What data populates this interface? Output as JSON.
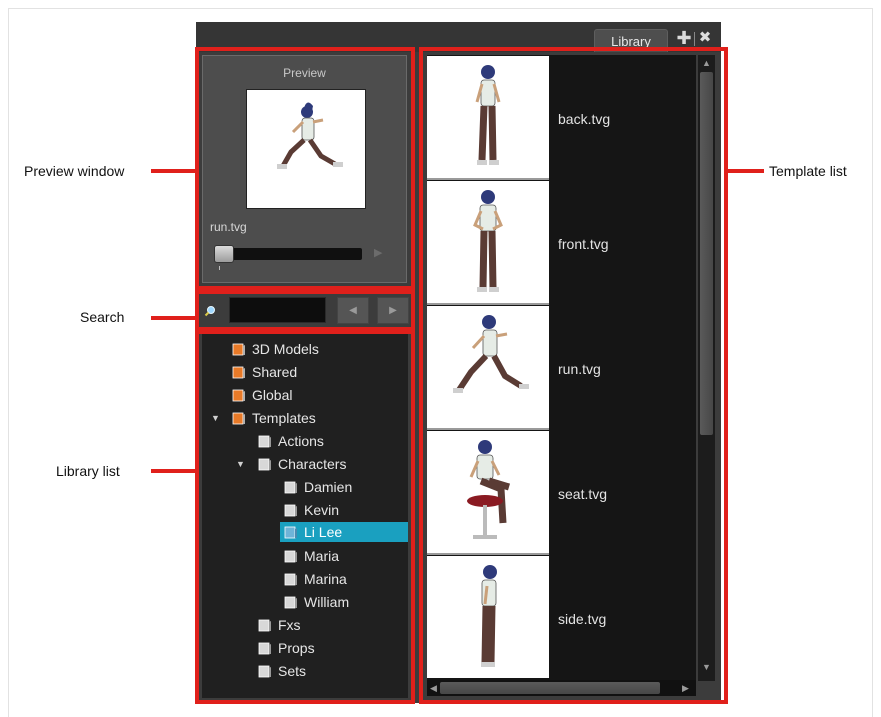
{
  "panel": {
    "tab_label": "Library",
    "tab_actions": [
      {
        "icon": "plus-icon",
        "glyph": "✚"
      },
      {
        "icon": "close-icon",
        "glyph": "✖"
      }
    ]
  },
  "preview": {
    "title": "Preview",
    "file_name": "run.tvg",
    "play_glyph": "▶"
  },
  "search": {
    "value": "",
    "prev_glyph": "◀",
    "next_glyph": "▶"
  },
  "library_tree": [
    {
      "label": "3D Models",
      "level": 0,
      "expanded": null,
      "selected": false,
      "folder_color": "#e87a28"
    },
    {
      "label": "Shared",
      "level": 0,
      "expanded": null,
      "selected": false,
      "folder_color": "#e87a28"
    },
    {
      "label": "Global",
      "level": 0,
      "expanded": null,
      "selected": false,
      "folder_color": "#e87a28"
    },
    {
      "label": "Templates",
      "level": 0,
      "expanded": true,
      "selected": false,
      "folder_color": "#e87a28"
    },
    {
      "label": "Actions",
      "level": 1,
      "expanded": null,
      "selected": false,
      "folder_color": "#d8d8d8"
    },
    {
      "label": "Characters",
      "level": 1,
      "expanded": true,
      "selected": false,
      "folder_color": "#d8d8d8"
    },
    {
      "label": "Damien",
      "level": 2,
      "expanded": null,
      "selected": false,
      "folder_color": "#d8d8d8"
    },
    {
      "label": "Kevin",
      "level": 2,
      "expanded": null,
      "selected": false,
      "folder_color": "#d8d8d8"
    },
    {
      "label": "Li Lee",
      "level": 2,
      "expanded": null,
      "selected": true,
      "folder_color": "#6fb4d8"
    },
    {
      "label": "Maria",
      "level": 2,
      "expanded": null,
      "selected": false,
      "folder_color": "#d8d8d8"
    },
    {
      "label": "Marina",
      "level": 2,
      "expanded": null,
      "selected": false,
      "folder_color": "#d8d8d8"
    },
    {
      "label": "William",
      "level": 2,
      "expanded": null,
      "selected": false,
      "folder_color": "#d8d8d8"
    },
    {
      "label": "Fxs",
      "level": 1,
      "expanded": null,
      "selected": false,
      "folder_color": "#d8d8d8"
    },
    {
      "label": "Props",
      "level": 1,
      "expanded": null,
      "selected": false,
      "folder_color": "#d8d8d8"
    },
    {
      "label": "Sets",
      "level": 1,
      "expanded": null,
      "selected": false,
      "folder_color": "#d8d8d8"
    }
  ],
  "templates": [
    {
      "name": "back.tvg",
      "pose": "standing-back"
    },
    {
      "name": "front.tvg",
      "pose": "standing-front"
    },
    {
      "name": "run.tvg",
      "pose": "running"
    },
    {
      "name": "seat.tvg",
      "pose": "seated"
    },
    {
      "name": "side.tvg",
      "pose": "standing-side"
    }
  ],
  "callouts": {
    "preview_window": "Preview window",
    "search": "Search",
    "library_list": "Library list",
    "template_list": "Template list"
  },
  "colors": {
    "highlight_red": "#e0201b",
    "selection": "#1aa0c0",
    "panel_bg": "#3c3c3c"
  }
}
